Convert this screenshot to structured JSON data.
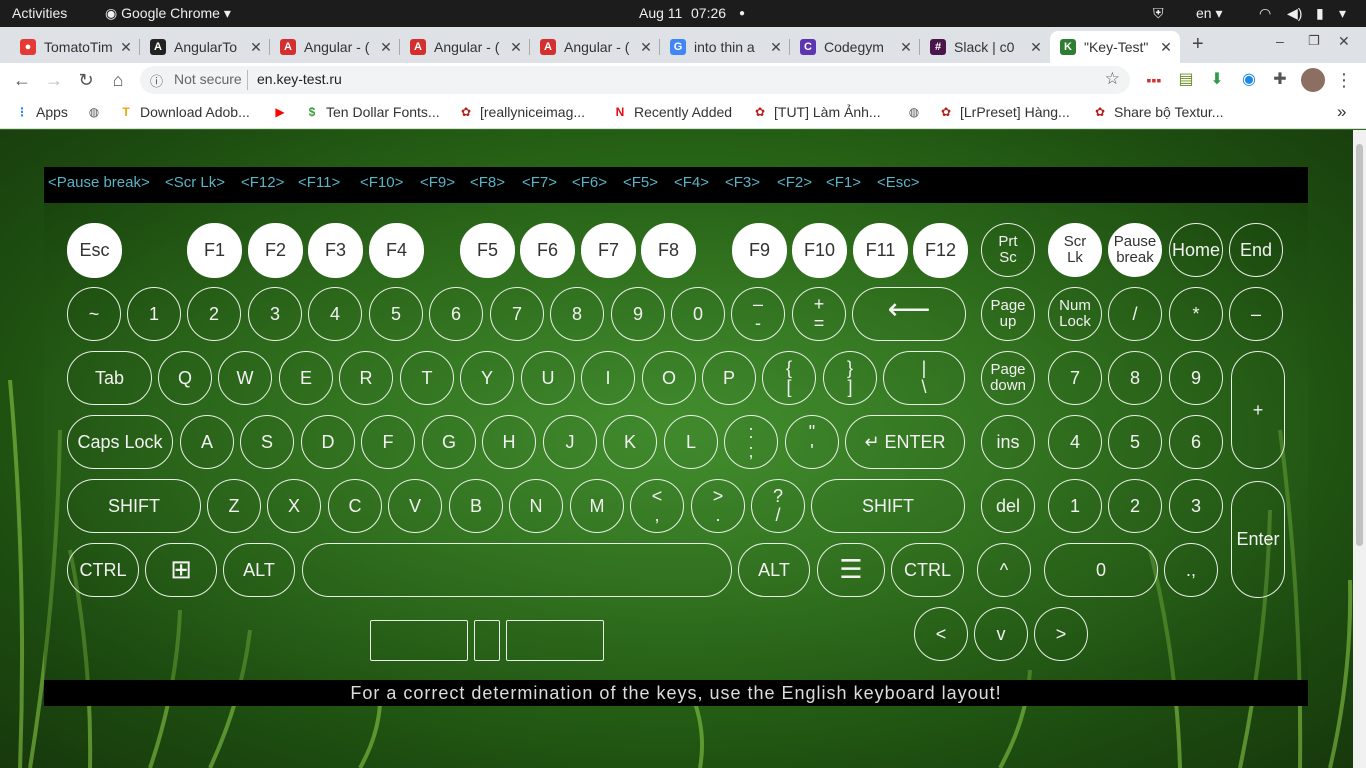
{
  "gnome": {
    "activities": "Activities",
    "app": "Google Chrome",
    "date": "Aug 11",
    "time": "07:26",
    "lang": "en"
  },
  "tabs": [
    {
      "title": "TomatoTim",
      "color": "#e53935",
      "glyph": "●"
    },
    {
      "title": "AngularTo",
      "color": "#222",
      "glyph": "A"
    },
    {
      "title": "Angular - (",
      "color": "#d32f2f",
      "glyph": "A"
    },
    {
      "title": "Angular - (",
      "color": "#d32f2f",
      "glyph": "A"
    },
    {
      "title": "Angular - (",
      "color": "#d32f2f",
      "glyph": "A"
    },
    {
      "title": "into thin a",
      "color": "#4285f4",
      "glyph": "G"
    },
    {
      "title": "Codegym",
      "color": "#5e35b1",
      "glyph": "C"
    },
    {
      "title": "Slack | c0",
      "color": "#4a154b",
      "glyph": "#"
    },
    {
      "title": "\"Key-Test\"",
      "color": "#2e7d32",
      "glyph": "K"
    }
  ],
  "toolbar": {
    "not_secure": "Not secure",
    "url": "en.key-test.ru"
  },
  "bookmarks": [
    {
      "label": "Apps",
      "color": "#4285f4",
      "glyph": "⋮"
    },
    {
      "label": "",
      "color": "#555",
      "glyph": "◍"
    },
    {
      "label": "Download Adob...",
      "color": "#f0a500",
      "glyph": "T"
    },
    {
      "label": "",
      "color": "#f00",
      "glyph": "▶"
    },
    {
      "label": "Ten Dollar Fonts...",
      "color": "#3a9d3a",
      "glyph": "$"
    },
    {
      "label": "[reallyniceimag...",
      "color": "#b71c1c",
      "glyph": "✿"
    },
    {
      "label": "Recently Added",
      "color": "#e50914",
      "glyph": "N"
    },
    {
      "label": "[TUT] Làm Ảnh...",
      "color": "#b71c1c",
      "glyph": "✿"
    },
    {
      "label": "",
      "color": "#555",
      "glyph": "◍"
    },
    {
      "label": "[LrPreset] Hàng...",
      "color": "#b71c1c",
      "glyph": "✿"
    },
    {
      "label": "Share bộ Textur...",
      "color": "#b71c1c",
      "glyph": "✿"
    }
  ],
  "history": [
    "<Pause break>",
    "<Scr Lk>",
    "<F12>",
    "<F11>",
    "<F10>",
    "<F9>",
    "<F8>",
    "<F7>",
    "<F6>",
    "<F5>",
    "<F4>",
    "<F3>",
    "<F2>",
    "<F1>",
    "<Esc>"
  ],
  "footer": "For a correct determination of the keys, use the English keyboard layout!",
  "keys": {
    "esc": "Esc",
    "f1": "F1",
    "f2": "F2",
    "f3": "F3",
    "f4": "F4",
    "f5": "F5",
    "f6": "F6",
    "f7": "F7",
    "f8": "F8",
    "f9": "F9",
    "f10": "F10",
    "f11": "F11",
    "f12": "F12",
    "prtsc": "Prt\nSc",
    "scrlk": "Scr\nLk",
    "pause": "Pause\nbreak",
    "home": "Home",
    "end": "End",
    "tilde": "~",
    "k1": "1",
    "k2": "2",
    "k3": "3",
    "k4": "4",
    "k5": "5",
    "k6": "6",
    "k7": "7",
    "k8": "8",
    "k9": "9",
    "k0": "0",
    "minus": "–\n-",
    "plus": "+\n=",
    "backspace": "⟵",
    "pgup": "Page\nup",
    "numlock": "Num\nLock",
    "npdiv": "/",
    "npmul": "*",
    "npminus": "–",
    "tab": "Tab",
    "q": "Q",
    "w": "W",
    "e": "E",
    "r": "R",
    "t": "T",
    "y": "Y",
    "u": "U",
    "i": "I",
    "o": "O",
    "p": "P",
    "lbr": "{\n[",
    "rbr": "}\n]",
    "bslash": "|\n\\",
    "pgdn": "Page\ndown",
    "np7": "7",
    "np8": "8",
    "np9": "9",
    "npplus": "+",
    "caps": "Caps Lock",
    "a": "A",
    "s": "S",
    "d": "D",
    "f": "F",
    "g": "G",
    "h": "H",
    "j": "J",
    "k": "K",
    "l": "L",
    "semi": ":\n;",
    "quote": "\"\n'",
    "enter": "↵ ENTER",
    "ins": "ins",
    "np4": "4",
    "np5": "5",
    "np6": "6",
    "lshift": "SHIFT",
    "z": "Z",
    "x": "X",
    "c": "C",
    "v": "V",
    "b": "B",
    "n": "N",
    "m": "M",
    "comma": "<\n,",
    "period": ">\n.",
    "slash": "?\n/",
    "rshift": "SHIFT",
    "del": "del",
    "np1": "1",
    "np2": "2",
    "np3": "3",
    "npenter": "Enter",
    "lctrl": "CTRL",
    "win": "⊞",
    "lalt": "ALT",
    "space": "",
    "ralt": "ALT",
    "menu": "☰",
    "rctrl": "CTRL",
    "up": "^",
    "np0": "0",
    "npdot": ".,",
    "left": "<",
    "down": "v",
    "right": ">"
  }
}
